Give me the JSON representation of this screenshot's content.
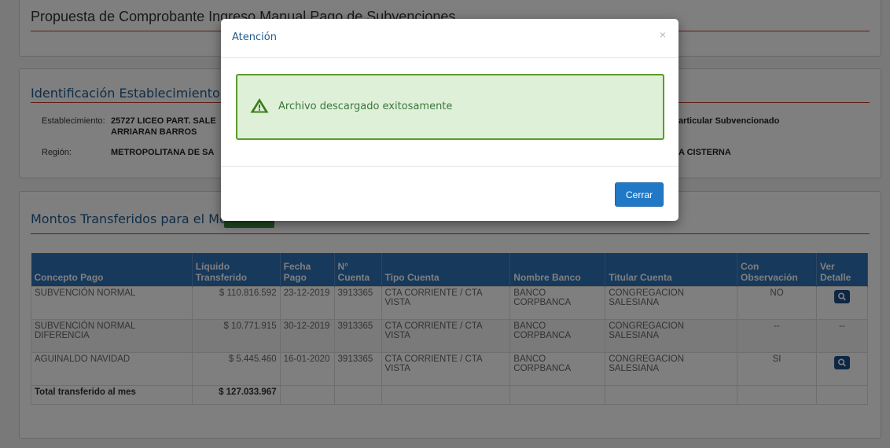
{
  "page_title": "Propuesta de Comprobante Ingreso Manual Pago de Subvenciones",
  "establishment": {
    "section_title": "Identificación Establecimiento:",
    "establecimiento_label": "Establecimiento:",
    "establecimiento_value_line1": "25727 LICEO PART. SALE",
    "establecimiento_value_line2": "ARRIARAN BARROS",
    "dependencia_value": "articular Subvencionado",
    "region_label": "Región:",
    "region_value": "METROPOLITANA DE SA",
    "comuna_value": "A CISTERNA"
  },
  "transfers": {
    "section_title": "Montos Transferidos para el Mes:",
    "headers": [
      "Concepto Pago",
      "Líquido Transferido",
      "Fecha Pago",
      "N° Cuenta",
      "Tipo Cuenta",
      "Nombre Banco",
      "Titular Cuenta",
      "Con Observación",
      "Ver Detalle"
    ],
    "rows": [
      {
        "concepto": "SUBVENCIÓN NORMAL",
        "liquido": "$ 110.816.592",
        "fecha": "23-12-2019",
        "cuenta": "3913365",
        "tipo": "CTA CORRIENTE / CTA VISTA",
        "banco": "BANCO CORPBANCA",
        "titular": "CONGREGACION SALESIANA",
        "observacion": "NO",
        "detalle": "search-button"
      },
      {
        "concepto": "SUBVENCIÓN NORMAL DIFERENCIA",
        "liquido": "$ 10.771.915",
        "fecha": "30-12-2019",
        "cuenta": "3913365",
        "tipo": "CTA CORRIENTE / CTA VISTA",
        "banco": "BANCO CORPBANCA",
        "titular": "CONGREGACION SALESIANA",
        "observacion": "--",
        "detalle": "--"
      },
      {
        "concepto": "AGUINALDO NAVIDAD",
        "liquido": "$ 5.445.460",
        "fecha": "16-01-2020",
        "cuenta": "3913365",
        "tipo": "CTA CORRIENTE / CTA VISTA",
        "banco": "BANCO CORPBANCA",
        "titular": "CONGREGACION SALESIANA",
        "observacion": "SI",
        "detalle": "search-button"
      }
    ],
    "total_label": "Total transferido al mes",
    "total_value": "$ 127.033.967"
  },
  "modal": {
    "title": "Atención",
    "close_symbol": "×",
    "message": "Archivo descargado exitosamente",
    "icon": "warning-triangle-icon",
    "button_label": "Cerrar"
  },
  "colors": {
    "header_blue": "#2e73b6",
    "title_blue": "#1f5a8e",
    "accent_red": "#c0392b",
    "alert_green": "#5c9a2b",
    "alert_bg": "#dff0d8",
    "button_blue": "#2078c6"
  }
}
